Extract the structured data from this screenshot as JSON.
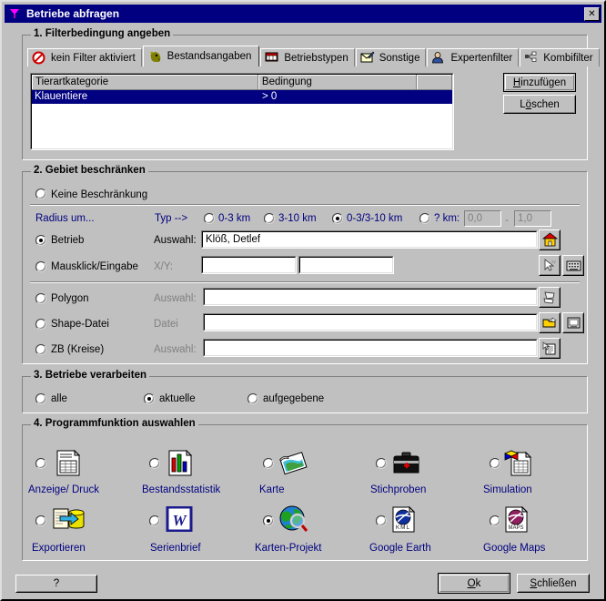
{
  "window": {
    "title": "Betriebe abfragen",
    "title_icon": "funnel-filter-icon",
    "close_label": "✕"
  },
  "section1": {
    "title": "1. Filterbedingung angeben",
    "tabs": [
      {
        "label": "kein Filter aktiviert",
        "icon": "no-entry-icon",
        "active": false
      },
      {
        "label": "Bestandsangaben",
        "icon": "animal-head-icon",
        "active": true
      },
      {
        "label": "Betriebstypen",
        "icon": "building-icon",
        "active": false
      },
      {
        "label": "Sonstige",
        "icon": "envelope-pencil-icon",
        "active": false
      },
      {
        "label": "Expertenfilter",
        "icon": "person-icon",
        "active": false
      },
      {
        "label": "Kombifilter",
        "icon": "network-nodes-icon",
        "active": false
      }
    ],
    "list": {
      "columns": [
        "Tierartkategorie",
        "Bedingung",
        ""
      ],
      "rows": [
        {
          "tierartkategorie": "Klauentiere",
          "bedingung": "> 0",
          "selected": true
        }
      ]
    },
    "buttons": {
      "add": "Hinzufügen",
      "add_accel": "H",
      "delete": "Löschen",
      "delete_accel": "ö"
    }
  },
  "section2": {
    "title": "2. Gebiet beschränken",
    "no_restriction": {
      "label": "Keine Beschränkung",
      "selected": false
    },
    "radius_label": "Radius um...",
    "typ_label": "Typ -->",
    "typ_options": [
      {
        "label": "0-3 km",
        "selected": false
      },
      {
        "label": "3-10 km",
        "selected": false
      },
      {
        "label": "0-3/3-10 km",
        "selected": true
      },
      {
        "label": "? km:",
        "selected": false
      }
    ],
    "km_from": "0,0",
    "km_sep": "-",
    "km_to": "1,0",
    "rows": [
      {
        "radio_label": "Betrieb",
        "selected": true,
        "field_label": "Auswahl:",
        "field_label_disabled": false,
        "value": "",
        "tools": [
          "house-icon"
        ]
      },
      {
        "radio_label": "Mausklick/Eingabe",
        "selected": false,
        "field_label": "X/Y:",
        "field_label_disabled": true,
        "value": "",
        "tools": [
          "cursor-xy-icon",
          "keyboard-icon"
        ]
      },
      {
        "radio_label": "Polygon",
        "selected": false,
        "field_label": "Auswahl:",
        "field_label_disabled": true,
        "value": "",
        "tools": [
          "polygon-shape-icon"
        ]
      },
      {
        "radio_label": "Shape-Datei",
        "selected": false,
        "field_label": "Datei",
        "field_label_disabled": true,
        "value": "",
        "tools": [
          "open-folder-icon",
          "disk-icon"
        ]
      },
      {
        "radio_label": "ZB (Kreise)",
        "selected": false,
        "field_label": "Auswahl:",
        "field_label_disabled": true,
        "value": "",
        "tools": [
          "document-pointer-icon"
        ]
      }
    ],
    "betrieb_value": "Klöß, Detlef"
  },
  "section3": {
    "title": "3. Betriebe verarbeiten",
    "options": [
      {
        "label": "alle",
        "selected": false
      },
      {
        "label": "aktuelle",
        "selected": true
      },
      {
        "label": "aufgegebene",
        "selected": false
      }
    ]
  },
  "section4": {
    "title": "4. Programmfunktion auswahlen",
    "items": [
      {
        "label": "Anzeige/ Druck",
        "icon": "document-table-icon",
        "selected": false
      },
      {
        "label": "Bestandsstatistik",
        "icon": "bar-chart-document-icon",
        "selected": false
      },
      {
        "label": "Karte",
        "icon": "map-icon",
        "selected": false
      },
      {
        "label": "Stichproben",
        "icon": "medical-bag-icon",
        "selected": false
      },
      {
        "label": "Simulation",
        "icon": "cube-document-icon",
        "selected": false
      },
      {
        "label": "Exportieren",
        "icon": "export-database-icon",
        "selected": false
      },
      {
        "label": "Serienbrief",
        "icon": "word-icon",
        "selected": false
      },
      {
        "label": "Karten-Projekt",
        "icon": "globe-magnifier-icon",
        "selected": true
      },
      {
        "label": "Google Earth",
        "icon": "kml-globe-icon",
        "selected": false
      },
      {
        "label": "Google Maps",
        "icon": "maps-globe-icon",
        "selected": false
      }
    ]
  },
  "footer": {
    "help": "?",
    "ok": "Ok",
    "ok_accel": "O",
    "close": "Schließen",
    "close_accel": "S"
  },
  "colors": {
    "window_bg": "#c0c0c0",
    "titlebar": "#000080",
    "selection": "#000080",
    "link_blue": "#000080",
    "disabled": "#808080"
  }
}
